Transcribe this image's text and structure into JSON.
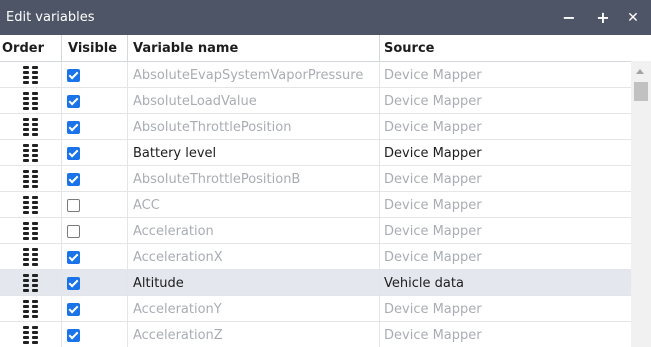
{
  "window": {
    "title": "Edit variables",
    "minimize_glyph": "−",
    "maximize_glyph": "+",
    "close_glyph": "✕"
  },
  "columns": {
    "order": "Order",
    "visible": "Visible",
    "name": "Variable name",
    "source": "Source"
  },
  "rows": [
    {
      "visible": true,
      "active": false,
      "selected": false,
      "name": "AbsoluteEvapSystemVaporPressure",
      "source": "Device Mapper"
    },
    {
      "visible": true,
      "active": false,
      "selected": false,
      "name": "AbsoluteLoadValue",
      "source": "Device Mapper"
    },
    {
      "visible": true,
      "active": false,
      "selected": false,
      "name": "AbsoluteThrottlePosition",
      "source": "Device Mapper"
    },
    {
      "visible": true,
      "active": true,
      "selected": false,
      "name": "Battery level",
      "source": "Device Mapper"
    },
    {
      "visible": true,
      "active": false,
      "selected": false,
      "name": "AbsoluteThrottlePositionB",
      "source": "Device Mapper"
    },
    {
      "visible": false,
      "active": false,
      "selected": false,
      "name": "ACC",
      "source": "Device Mapper"
    },
    {
      "visible": false,
      "active": false,
      "selected": false,
      "name": "Acceleration",
      "source": "Device Mapper"
    },
    {
      "visible": true,
      "active": false,
      "selected": false,
      "name": "AccelerationX",
      "source": "Device Mapper"
    },
    {
      "visible": true,
      "active": true,
      "selected": true,
      "name": "Altitude",
      "source": "Vehicle data"
    },
    {
      "visible": true,
      "active": false,
      "selected": false,
      "name": "AccelerationY",
      "source": "Device Mapper"
    },
    {
      "visible": true,
      "active": false,
      "selected": false,
      "name": "AccelerationZ",
      "source": "Device Mapper"
    }
  ],
  "colors": {
    "titlebar": "#4d5566",
    "checkbox_checked": "#1a73e8",
    "selected_row": "#e4e7ed",
    "inactive_text": "#a9adb3",
    "active_text": "#1d1d1d"
  },
  "icons": {
    "drag_handle": "drag-handle-icon",
    "minimize": "minimize-icon",
    "maximize": "maximize-icon",
    "close": "close-icon",
    "scroll_up": "scroll-up-arrow-icon"
  }
}
